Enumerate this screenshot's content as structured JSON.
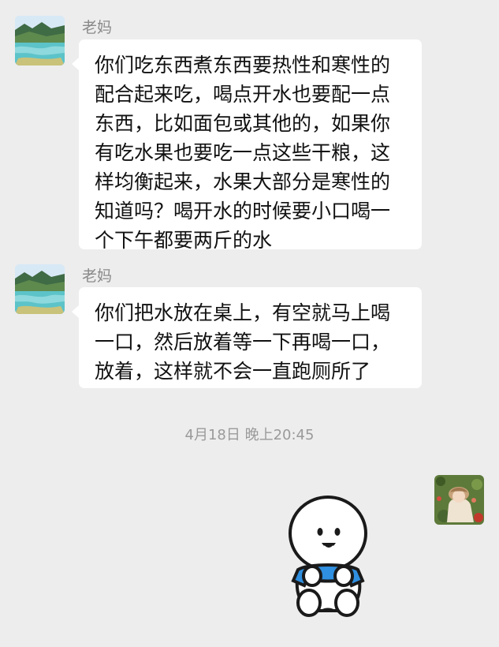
{
  "messages": [
    {
      "sender": "老妈",
      "lines": [
        "你们吃东西煮东西要热性和寒性的",
        "配合起来吃，喝点开水也要配一点",
        "东西，比如面包或其他的，如果你",
        "有吃水果也要吃一点这些干粮，这",
        "样均衡起来，水果大部分是寒性的",
        "知道吗？喝开水的时候要小口喝一",
        "个下午都要两斤的水"
      ]
    },
    {
      "sender": "老妈",
      "lines": [
        "你们把水放在桌上，有空就马上喝",
        "一口，然后放着等一下再喝一口，",
        "放着，这样就不会一直跑厕所了"
      ]
    }
  ],
  "timestamp": "4月18日 晚上20:45",
  "icons": {
    "sender_avatar": "landscape-lake-avatar-icon",
    "self_avatar": "portrait-photo-avatar-icon",
    "sticker": "cartoon-blob-sticker"
  },
  "colors": {
    "background": "#ededed",
    "bubble": "#ffffff",
    "sticker_shirt": "#2f8fe0"
  }
}
